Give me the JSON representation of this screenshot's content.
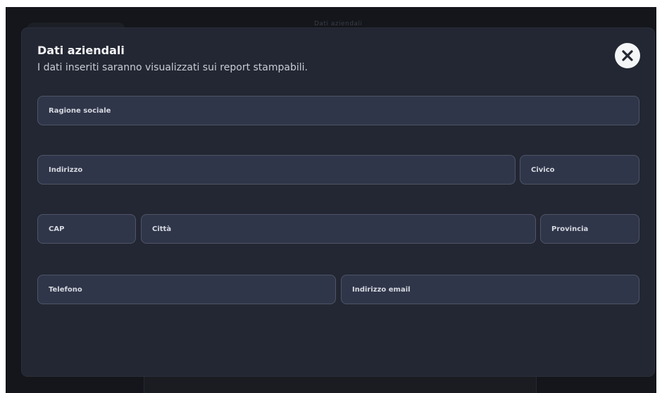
{
  "background": {
    "top_text": "Dati aziendali"
  },
  "modal": {
    "title": "Dati aziendali",
    "subtitle": "I dati inseriti saranno visualizzati sui report stampabili.",
    "close_icon": "close-icon"
  },
  "form": {
    "ragione_sociale": {
      "placeholder": "Ragione sociale",
      "value": ""
    },
    "indirizzo": {
      "placeholder": "Indirizzo",
      "value": ""
    },
    "civico": {
      "placeholder": "Civico",
      "value": ""
    },
    "cap": {
      "placeholder": "CAP",
      "value": ""
    },
    "citta": {
      "placeholder": "Città",
      "value": ""
    },
    "provincia": {
      "placeholder": "Provincia",
      "value": ""
    },
    "telefono": {
      "placeholder": "Telefono",
      "value": ""
    },
    "email": {
      "placeholder": "Indirizzo email",
      "value": ""
    }
  },
  "colors": {
    "background": "#14161b",
    "modal": "#232733",
    "field": "#30364a",
    "field_border": "#4f5566",
    "close_button": "#f4f5f7"
  }
}
